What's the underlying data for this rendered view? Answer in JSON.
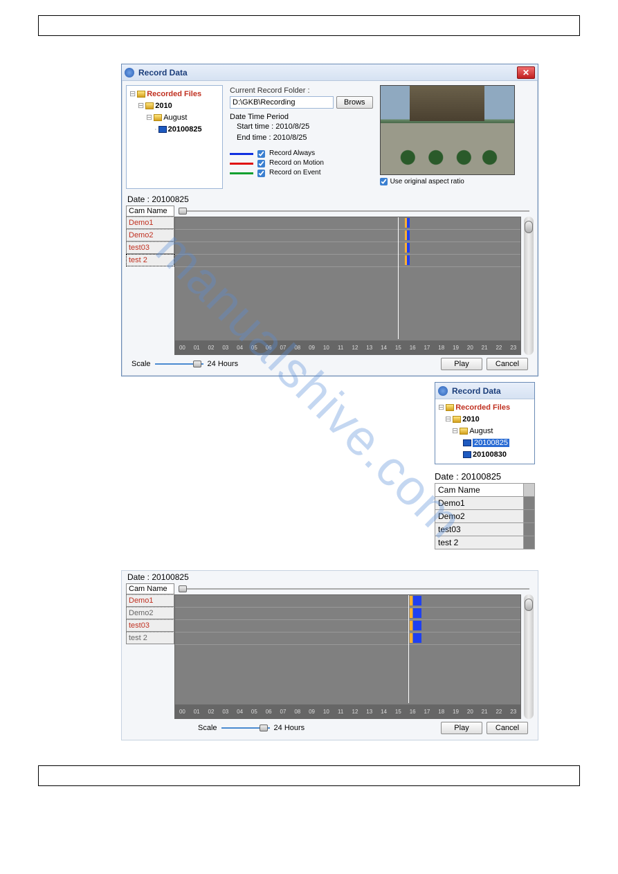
{
  "window_title": "Record Data",
  "tree": {
    "root": "Recorded Files",
    "year": "2010",
    "month": "August",
    "date1": "20100825",
    "date2": "20100830"
  },
  "folder": {
    "label": "Current Record Folder :",
    "path": "D:\\GKB\\Recording",
    "browse": "Brows"
  },
  "period": {
    "heading": "Date Time Period",
    "start_label": "Start time :",
    "start_val": "2010/8/25",
    "end_label": "End time :",
    "end_val": "2010/8/25"
  },
  "legend": {
    "always": "Record Always",
    "motion": "Record on Motion",
    "event": "Record on Event"
  },
  "aspect": "Use original aspect ratio",
  "date_label": "Date :",
  "date_val": "20100825",
  "cam_head": "Cam Name",
  "cams": [
    "Demo1",
    "Demo2",
    "test03",
    "test 2"
  ],
  "ticks": [
    "00",
    "01",
    "02",
    "03",
    "04",
    "05",
    "06",
    "07",
    "08",
    "09",
    "10",
    "11",
    "12",
    "13",
    "14",
    "15",
    "16",
    "17",
    "18",
    "19",
    "20",
    "21",
    "22",
    "23"
  ],
  "scale_label": "Scale",
  "scale_val": "24 Hours",
  "play": "Play",
  "cancel": "Cancel",
  "watermark": "manualshive.com",
  "chart_data": {
    "type": "timeline",
    "date": "20100825",
    "x_range_hours": [
      0,
      24
    ],
    "cameras": [
      {
        "name": "Demo1",
        "marks_upper": [
          {
            "hour": 16.0,
            "type": "event",
            "color": "orange"
          }
        ],
        "marks_lower": [
          {
            "hour": 16.4,
            "type": "always",
            "color": "blue",
            "width_hours": 0.4
          }
        ]
      },
      {
        "name": "Demo2",
        "marks_upper": [
          {
            "hour": 16.0,
            "type": "event",
            "color": "orange"
          }
        ],
        "marks_lower": [
          {
            "hour": 16.4,
            "type": "always",
            "color": "blue",
            "width_hours": 0.4
          }
        ]
      },
      {
        "name": "test03",
        "marks_upper": [
          {
            "hour": 16.0,
            "type": "event",
            "color": "orange"
          }
        ],
        "marks_lower": [
          {
            "hour": 16.4,
            "type": "always",
            "color": "blue",
            "width_hours": 0.4
          }
        ]
      },
      {
        "name": "test 2",
        "marks_upper": [
          {
            "hour": 16.0,
            "type": "event",
            "color": "orange"
          }
        ],
        "marks_lower": [
          {
            "hour": 16.4,
            "type": "always",
            "color": "blue",
            "width_hours": 0.4
          }
        ]
      }
    ],
    "cursor_hour_upper": 15.5,
    "cursor_hour_lower": 16.2
  }
}
